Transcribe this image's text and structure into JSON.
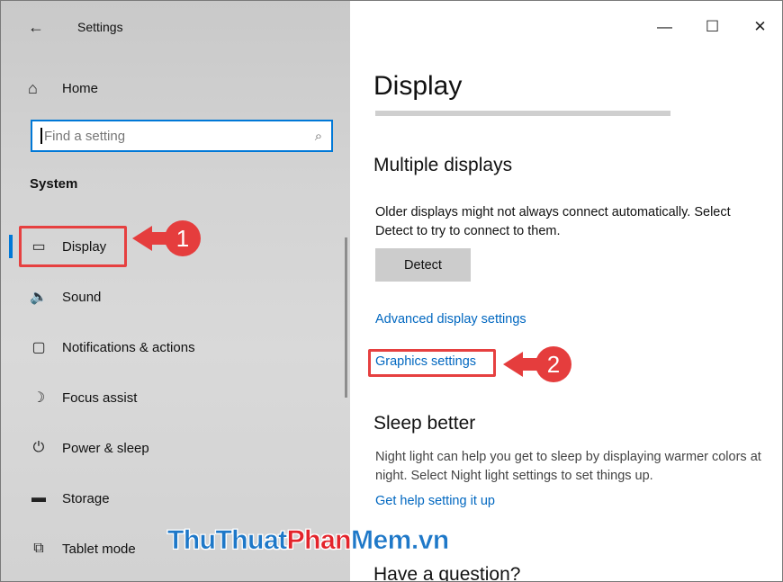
{
  "window": {
    "title": "Settings",
    "controls": {
      "minimize": "—",
      "maximize": "☐",
      "close": "✕"
    }
  },
  "sidebar": {
    "back_icon": "←",
    "home": {
      "icon": "⌂",
      "label": "Home"
    },
    "search": {
      "placeholder": "Find a setting",
      "icon": "⌕"
    },
    "section_label": "System",
    "items": [
      {
        "icon": "▭",
        "label": "Display",
        "selected": true
      },
      {
        "icon": "🔈",
        "label": "Sound"
      },
      {
        "icon": "▢",
        "label": "Notifications & actions"
      },
      {
        "icon": "☽",
        "label": "Focus assist"
      },
      {
        "icon": "⏻",
        "label": "Power & sleep"
      },
      {
        "icon": "▬",
        "label": "Storage"
      },
      {
        "icon": "⧉",
        "label": "Tablet mode"
      }
    ]
  },
  "main": {
    "title": "Display",
    "multiple_displays": {
      "heading": "Multiple displays",
      "description": "Older displays might not always connect automatically. Select Detect to try to connect to them.",
      "detect_label": "Detect"
    },
    "advanced_link": "Advanced display settings",
    "graphics_link": "Graphics settings",
    "sleep_better": {
      "heading": "Sleep better",
      "description": "Night light can help you get to sleep by displaying warmer colors at night. Select Night light settings to set things up.",
      "help_link": "Get help setting it up"
    },
    "question_heading": "Have a question?"
  },
  "annotations": {
    "callout_1": "1",
    "callout_2": "2"
  },
  "watermark": {
    "part1": "ThuThuat",
    "part2": "Phan",
    "part3": "Mem",
    "part4": ".vn"
  },
  "colors": {
    "accent": "#0078d7",
    "link": "#0067c0",
    "highlight": "#e64040"
  }
}
